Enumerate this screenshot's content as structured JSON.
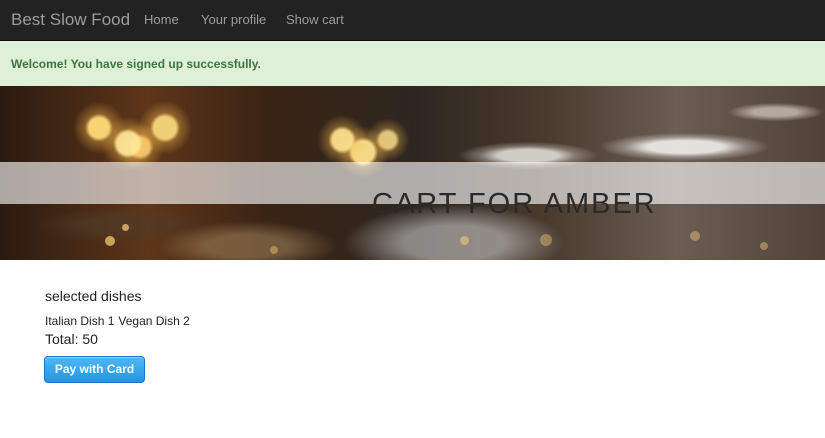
{
  "navbar": {
    "brand": "Best Slow Food",
    "links": [
      {
        "label": "Home"
      },
      {
        "label": "Your profile"
      },
      {
        "label": "Show cart"
      }
    ]
  },
  "alert": {
    "message": "Welcome! You have signed up successfully.",
    "color": "#3c763d",
    "background": "#dff0d8"
  },
  "hero": {
    "title": "CART FOR AMBER"
  },
  "cart": {
    "heading": "selected dishes",
    "dishes": [
      "Italian Dish 1",
      "Vegan Dish 2"
    ],
    "total_label": "Total:",
    "total_value": "50",
    "pay_button_label": "Pay with Card",
    "accent_color": "#2596e4"
  }
}
